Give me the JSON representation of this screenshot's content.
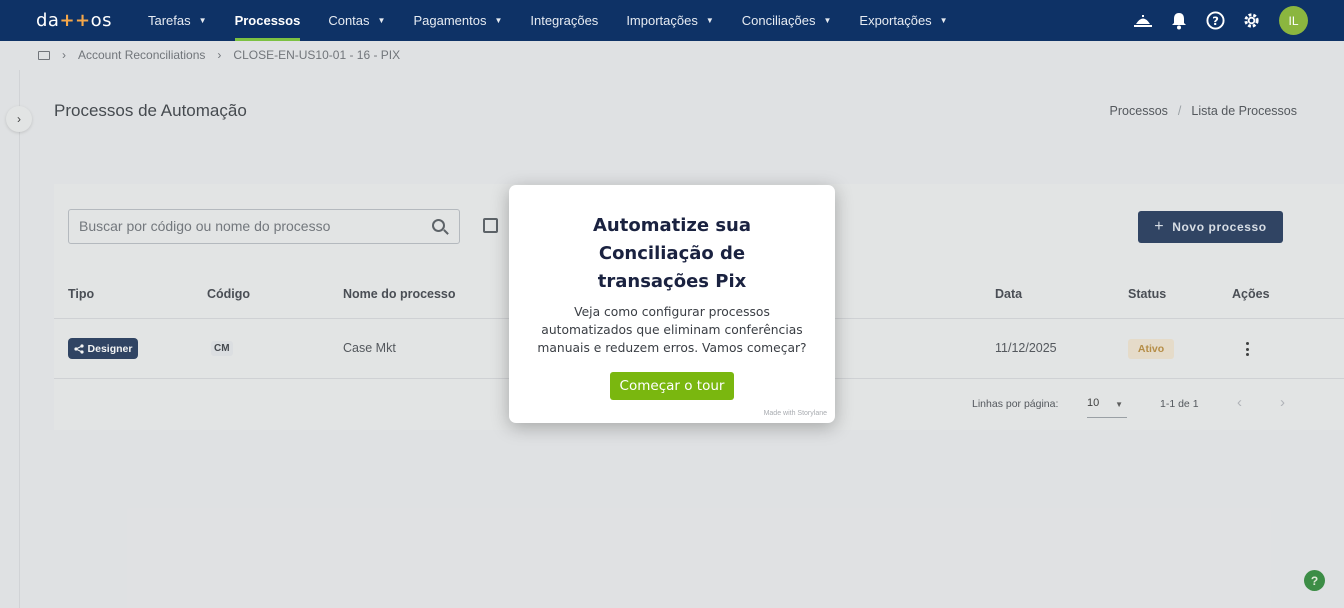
{
  "brand": {
    "logo_left": "da",
    "logo_plus": "++",
    "logo_right": "os"
  },
  "nav": {
    "items": [
      {
        "label": "Tarefas",
        "has_caret": true
      },
      {
        "label": "Processos",
        "active": true
      },
      {
        "label": "Contas",
        "has_caret": true
      },
      {
        "label": "Pagamentos",
        "has_caret": true
      },
      {
        "label": "Integrações"
      },
      {
        "label": "Importações",
        "has_caret": true
      },
      {
        "label": "Conciliações",
        "has_caret": true
      },
      {
        "label": "Exportações",
        "has_caret": true
      }
    ],
    "avatar_initials": "IL"
  },
  "breadcrumb": {
    "items": [
      "Account Reconciliations",
      "CLOSE-EN-US10-01 - 16 - PIX"
    ]
  },
  "page": {
    "title": "Processos de Automação",
    "crumbs": [
      "Processos",
      "Lista de Processos"
    ]
  },
  "toolbar": {
    "search_placeholder": "Buscar por código ou nome do processo",
    "new_button_label": "Novo processo"
  },
  "table": {
    "headers": {
      "tipo": "Tipo",
      "codigo": "Código",
      "nome": "Nome do processo",
      "data": "Data",
      "status": "Status",
      "acoes": "Ações"
    },
    "rows": [
      {
        "tipo": "Designer",
        "codigo": "CM",
        "nome": "Case Mkt",
        "data": "11/12/2025",
        "status": "Ativo"
      }
    ]
  },
  "pagination": {
    "rows_label": "Linhas por página:",
    "rows_value": "10",
    "range": "1-1 de 1"
  },
  "modal": {
    "title": "Automatize sua Conciliação de transações Pix",
    "text": "Veja como configurar processos automatizados que eliminam conferências manuais e reduzem erros. Vamos começar?",
    "button_label": "Começar o tour",
    "footer": "Made with Storylane"
  },
  "help_fab_label": "?",
  "colors": {
    "topbar": "#0e3266",
    "accent_green": "#7ab70f",
    "primary_button": "#22375a"
  }
}
